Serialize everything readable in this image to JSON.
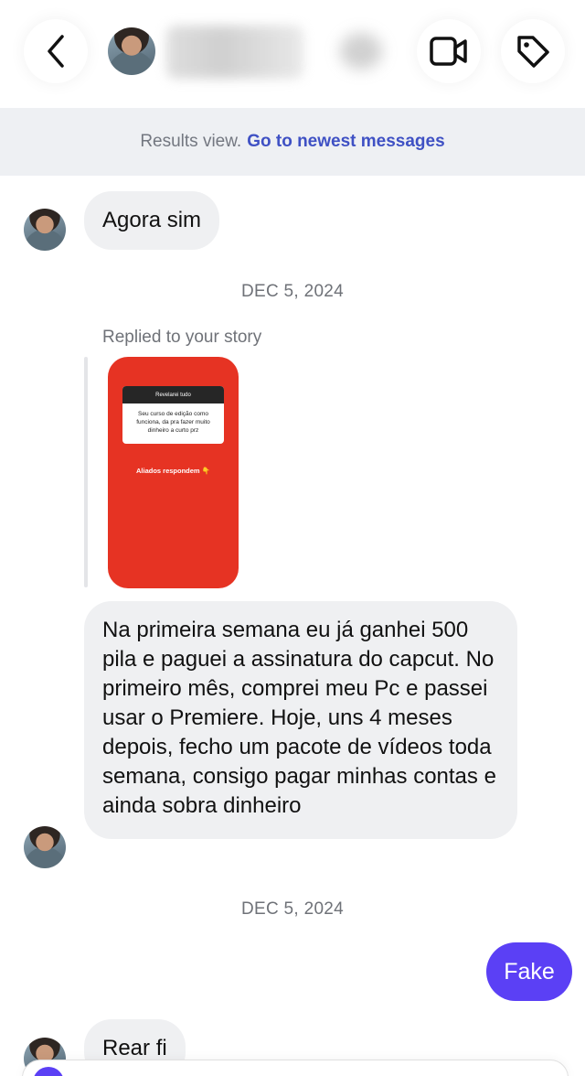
{
  "header": {
    "back_icon": "chevron-left-icon",
    "video_icon": "video-camera-icon",
    "tag_icon": "tag-icon"
  },
  "results_bar": {
    "text": "Results view.",
    "link": "Go to newest messages"
  },
  "messages": {
    "m1": "Agora sim",
    "date1": "DEC 5, 2024",
    "replied_label": "Replied to your story",
    "story": {
      "card_title": "Revelarei tudo",
      "card_text": "Seu curso de edição como funciona, da pra fazer muito dinheiro a curto prz",
      "cta": "Aliados respondem 👇"
    },
    "m2": "Na primeira semana eu já ganhei 500 pila e paguei a assinatura do capcut. No primeiro mês, comprei meu Pc e passei usar o Premiere. Hoje, uns 4 meses depois, fecho um pacote de vídeos toda semana, consigo pagar minhas contas e ainda sobra dinheiro",
    "date2": "DEC 5, 2024",
    "m3_outgoing": "Fake",
    "m4": "Rear fi"
  },
  "colors": {
    "accent": "#5b40f5",
    "link": "#3f51c4",
    "bubble": "#eff0f2",
    "story_bg": "#e63323"
  }
}
